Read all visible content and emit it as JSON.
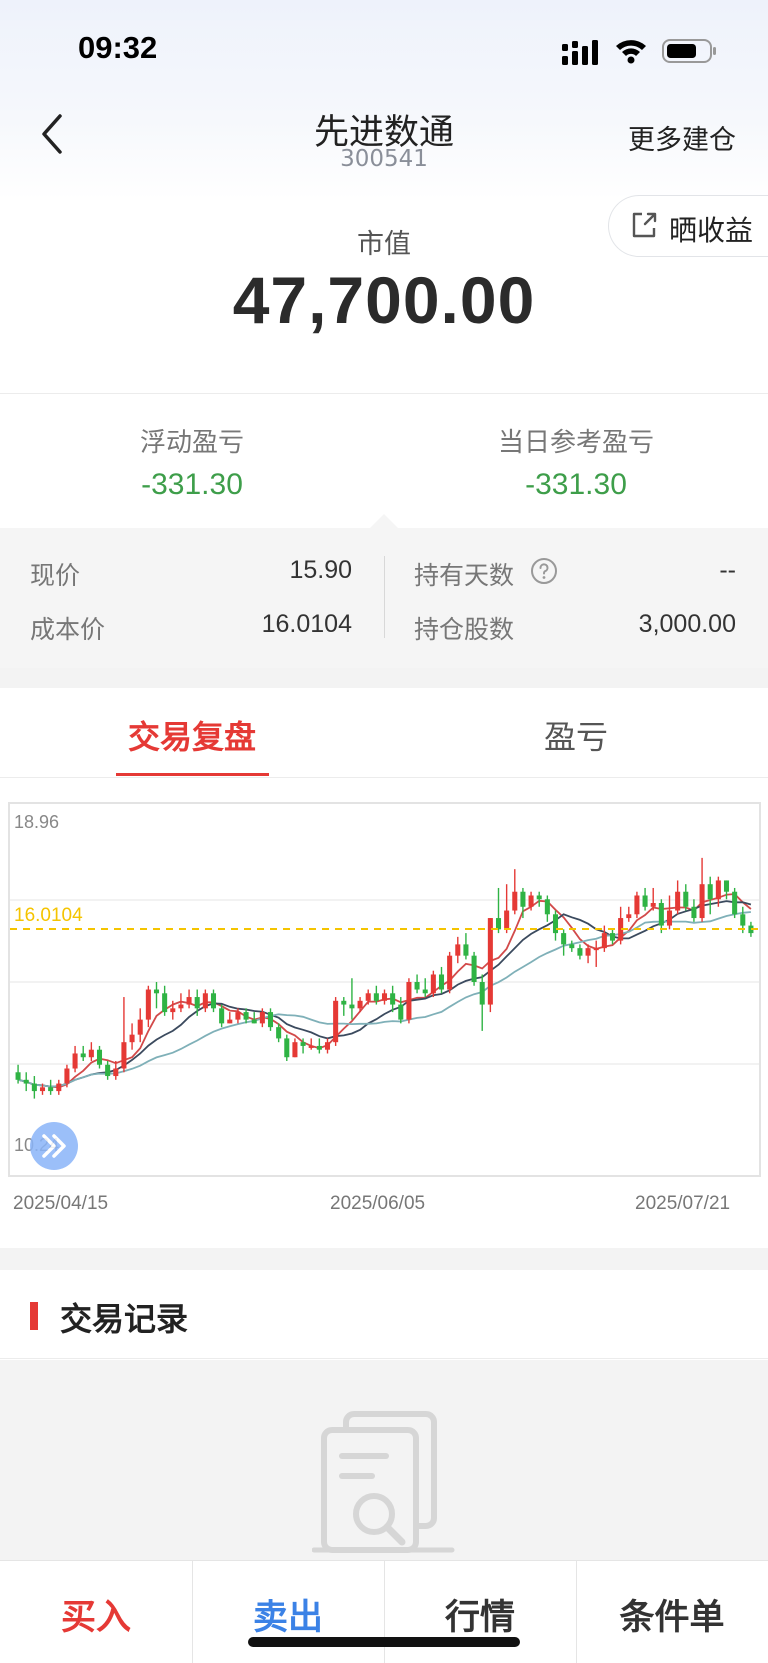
{
  "status_bar": {
    "time": "09:32"
  },
  "header": {
    "title": "先进数通",
    "code": "300541",
    "more_build": "更多建仓"
  },
  "share": {
    "label": "晒收益"
  },
  "market_value": {
    "label": "市值",
    "value": "47,700.00"
  },
  "pnl": {
    "floating": {
      "label": "浮动盈亏",
      "value": "-331.30"
    },
    "daily": {
      "label": "当日参考盈亏",
      "value": "-331.30"
    },
    "loss_color": "#3e9e4a"
  },
  "details": {
    "current_price": {
      "label": "现价",
      "value": "15.90"
    },
    "cost_price": {
      "label": "成本价",
      "value": "16.0104"
    },
    "holding_days": {
      "label": "持有天数",
      "value": "--"
    },
    "shares": {
      "label": "持仓股数",
      "value": "3,000.00"
    }
  },
  "tabs": [
    {
      "label": "交易复盘",
      "active": true
    },
    {
      "label": "盈亏",
      "active": false
    }
  ],
  "chart_data": {
    "type": "candlestick",
    "y_max_label": "18.96",
    "y_min_label": "10.24",
    "ylim": [
      10.24,
      18.96
    ],
    "cost_line": {
      "value": 16.0104,
      "label": "16.0104",
      "color": "#f5c400"
    },
    "x_labels": [
      "2025/04/15",
      "2025/06/05",
      "2025/07/21"
    ],
    "up_color": "#e53935",
    "down_color": "#2fb344",
    "candles": [
      [
        12.2,
        12.0,
        12.4,
        11.9
      ],
      [
        12.0,
        11.9,
        12.2,
        11.7
      ],
      [
        11.9,
        11.7,
        12.1,
        11.5
      ],
      [
        11.7,
        11.8,
        11.9,
        11.6
      ],
      [
        11.8,
        11.7,
        12.0,
        11.6
      ],
      [
        11.7,
        11.9,
        12.0,
        11.6
      ],
      [
        11.9,
        12.3,
        12.4,
        11.8
      ],
      [
        12.3,
        12.7,
        12.9,
        12.2
      ],
      [
        12.7,
        12.6,
        12.9,
        12.5
      ],
      [
        12.6,
        12.8,
        13.0,
        12.5
      ],
      [
        12.8,
        12.4,
        12.9,
        12.3
      ],
      [
        12.4,
        12.1,
        12.5,
        12.0
      ],
      [
        12.1,
        12.3,
        12.5,
        12.0
      ],
      [
        12.3,
        13.0,
        14.2,
        12.2
      ],
      [
        13.0,
        13.2,
        13.5,
        12.8
      ],
      [
        13.2,
        13.6,
        13.9,
        13.0
      ],
      [
        13.6,
        14.4,
        14.5,
        13.4
      ],
      [
        14.4,
        14.3,
        14.6,
        13.9
      ],
      [
        14.3,
        13.8,
        14.5,
        13.7
      ],
      [
        13.8,
        13.9,
        14.1,
        13.6
      ],
      [
        13.9,
        14.0,
        14.3,
        13.8
      ],
      [
        14.0,
        14.2,
        14.4,
        13.9
      ],
      [
        14.2,
        13.9,
        14.4,
        13.7
      ],
      [
        13.9,
        14.3,
        14.4,
        13.8
      ],
      [
        14.3,
        13.9,
        14.4,
        13.8
      ],
      [
        13.9,
        13.5,
        14.0,
        13.4
      ],
      [
        13.5,
        13.6,
        13.8,
        13.5
      ],
      [
        13.6,
        13.8,
        13.9,
        13.5
      ],
      [
        13.8,
        13.6,
        13.9,
        13.5
      ],
      [
        13.6,
        13.5,
        13.8,
        13.5
      ],
      [
        13.5,
        13.8,
        13.9,
        13.4
      ],
      [
        13.8,
        13.4,
        13.9,
        13.3
      ],
      [
        13.4,
        13.1,
        13.5,
        13.0
      ],
      [
        13.1,
        12.6,
        13.2,
        12.5
      ],
      [
        12.6,
        13.0,
        13.1,
        12.6
      ],
      [
        13.0,
        12.9,
        13.1,
        12.7
      ],
      [
        12.9,
        12.9,
        13.1,
        12.8
      ],
      [
        12.9,
        12.8,
        13.1,
        12.7
      ],
      [
        12.8,
        13.0,
        13.1,
        12.7
      ],
      [
        13.0,
        14.1,
        14.2,
        12.9
      ],
      [
        14.1,
        14.0,
        14.2,
        13.7
      ],
      [
        14.0,
        13.9,
        14.7,
        13.6
      ],
      [
        13.9,
        14.1,
        14.2,
        13.8
      ],
      [
        14.1,
        14.3,
        14.4,
        14.0
      ],
      [
        14.3,
        14.1,
        14.5,
        14.0
      ],
      [
        14.1,
        14.3,
        14.4,
        14.0
      ],
      [
        14.3,
        14.0,
        14.5,
        13.8
      ],
      [
        14.0,
        13.6,
        14.2,
        13.5
      ],
      [
        13.6,
        14.6,
        14.7,
        13.5
      ],
      [
        14.6,
        14.4,
        14.8,
        14.3
      ],
      [
        14.4,
        14.3,
        14.7,
        14.2
      ],
      [
        14.3,
        14.8,
        14.9,
        14.2
      ],
      [
        14.8,
        14.4,
        15.0,
        14.3
      ],
      [
        14.4,
        15.3,
        15.4,
        14.3
      ],
      [
        15.3,
        15.6,
        15.8,
        15.1
      ],
      [
        15.6,
        15.3,
        15.9,
        15.2
      ],
      [
        15.3,
        14.6,
        15.4,
        14.5
      ],
      [
        14.6,
        14.0,
        14.8,
        13.3
      ],
      [
        14.0,
        16.3,
        16.3,
        13.8
      ],
      [
        16.3,
        16.0,
        17.1,
        15.9
      ],
      [
        16.0,
        16.5,
        17.2,
        15.9
      ],
      [
        16.5,
        17.0,
        17.6,
        16.4
      ],
      [
        17.0,
        16.6,
        17.1,
        16.3
      ],
      [
        16.6,
        16.9,
        17.0,
        16.5
      ],
      [
        16.9,
        16.8,
        17.0,
        16.6
      ],
      [
        16.8,
        16.4,
        16.9,
        16.2
      ],
      [
        16.4,
        15.9,
        16.5,
        15.7
      ],
      [
        15.9,
        15.6,
        16.0,
        15.3
      ],
      [
        15.6,
        15.5,
        15.7,
        15.4
      ],
      [
        15.5,
        15.3,
        15.6,
        15.2
      ],
      [
        15.3,
        15.5,
        15.6,
        15.1
      ],
      [
        15.5,
        15.5,
        15.7,
        15.0
      ],
      [
        15.5,
        15.9,
        16.1,
        15.4
      ],
      [
        15.9,
        15.7,
        16.0,
        15.6
      ],
      [
        15.7,
        16.3,
        16.6,
        15.6
      ],
      [
        16.3,
        16.4,
        16.6,
        16.2
      ],
      [
        16.4,
        16.9,
        17.0,
        16.3
      ],
      [
        16.9,
        16.6,
        17.1,
        16.5
      ],
      [
        16.6,
        16.7,
        17.1,
        16.5
      ],
      [
        16.7,
        16.1,
        16.8,
        15.9
      ],
      [
        16.1,
        16.5,
        16.9,
        16.0
      ],
      [
        16.5,
        17.0,
        17.3,
        16.4
      ],
      [
        17.0,
        16.6,
        17.2,
        16.5
      ],
      [
        16.6,
        16.3,
        16.8,
        16.2
      ],
      [
        16.3,
        17.2,
        17.9,
        16.2
      ],
      [
        17.2,
        16.8,
        17.4,
        16.4
      ],
      [
        16.8,
        17.3,
        17.4,
        16.6
      ],
      [
        17.3,
        17.0,
        17.3,
        16.8
      ],
      [
        17.0,
        16.4,
        17.1,
        16.3
      ],
      [
        16.4,
        16.1,
        16.6,
        15.9
      ],
      [
        16.1,
        15.9,
        16.2,
        15.8
      ]
    ]
  },
  "records": {
    "title": "交易记录"
  },
  "bottom_bar": [
    {
      "label": "买入",
      "color": "#e53935"
    },
    {
      "label": "卖出",
      "color": "#3b82e6"
    },
    {
      "label": "行情",
      "color": "#333333"
    },
    {
      "label": "条件单",
      "color": "#333333"
    }
  ],
  "icons": [
    "back-icon",
    "signal-icon",
    "wifi-icon",
    "battery-icon",
    "share-icon",
    "help-icon",
    "fast-forward-icon",
    "empty-document-icon"
  ]
}
